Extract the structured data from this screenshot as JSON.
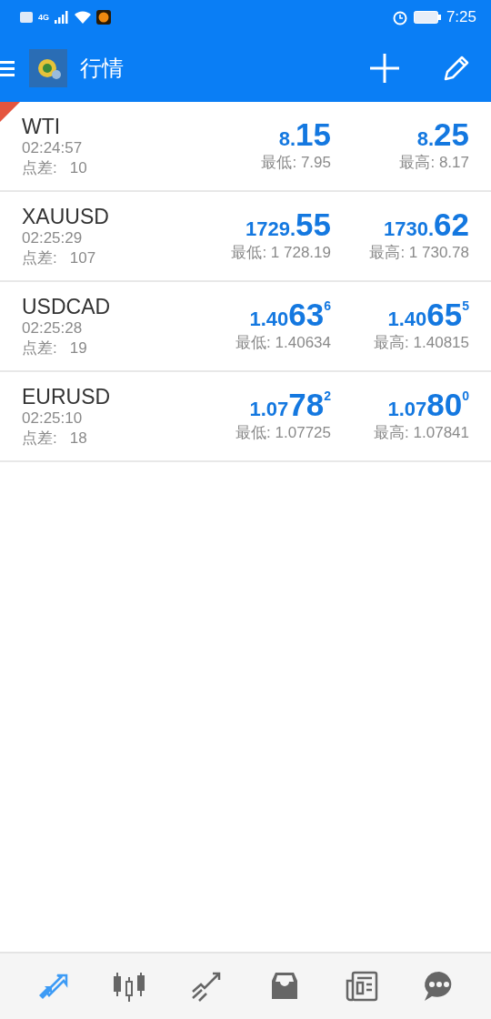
{
  "status_bar": {
    "network": "4G",
    "time": "7:25"
  },
  "app_bar": {
    "title": "行情"
  },
  "quotes": [
    {
      "symbol": "WTI",
      "time": "02:24:57",
      "spread_label": "点差:",
      "spread": "10",
      "marked": true,
      "bid": {
        "prefix": "8.",
        "big": "15"
      },
      "ask": {
        "prefix": "8.",
        "big": "25"
      },
      "low": "最低: 7.95",
      "high": "最高: 8.17"
    },
    {
      "symbol": "XAUUSD",
      "time": "02:25:29",
      "spread_label": "点差:",
      "spread": "107",
      "marked": false,
      "bid": {
        "prefix": "1729.",
        "big": "55"
      },
      "ask": {
        "prefix": "1730.",
        "big": "62"
      },
      "low": "最低: 1 728.19",
      "high": "最高: 1 730.78"
    },
    {
      "symbol": "USDCAD",
      "time": "02:25:28",
      "spread_label": "点差:",
      "spread": "19",
      "marked": false,
      "bid": {
        "prefix": "1.40",
        "big": "63",
        "sup": "6"
      },
      "ask": {
        "prefix": "1.40",
        "big": "65",
        "sup": "5"
      },
      "low": "最低: 1.40634",
      "high": "最高: 1.40815"
    },
    {
      "symbol": "EURUSD",
      "time": "02:25:10",
      "spread_label": "点差:",
      "spread": "18",
      "marked": false,
      "bid": {
        "prefix": "1.07",
        "big": "78",
        "sup": "2"
      },
      "ask": {
        "prefix": "1.07",
        "big": "80",
        "sup": "0"
      },
      "low": "最低: 1.07725",
      "high": "最高: 1.07841"
    }
  ],
  "bottom_nav": [
    {
      "kind": "quotes",
      "selected": true
    },
    {
      "kind": "chart",
      "selected": false
    },
    {
      "kind": "trade",
      "selected": false
    },
    {
      "kind": "history",
      "selected": false
    },
    {
      "kind": "news",
      "selected": false
    },
    {
      "kind": "chat",
      "selected": false
    }
  ]
}
